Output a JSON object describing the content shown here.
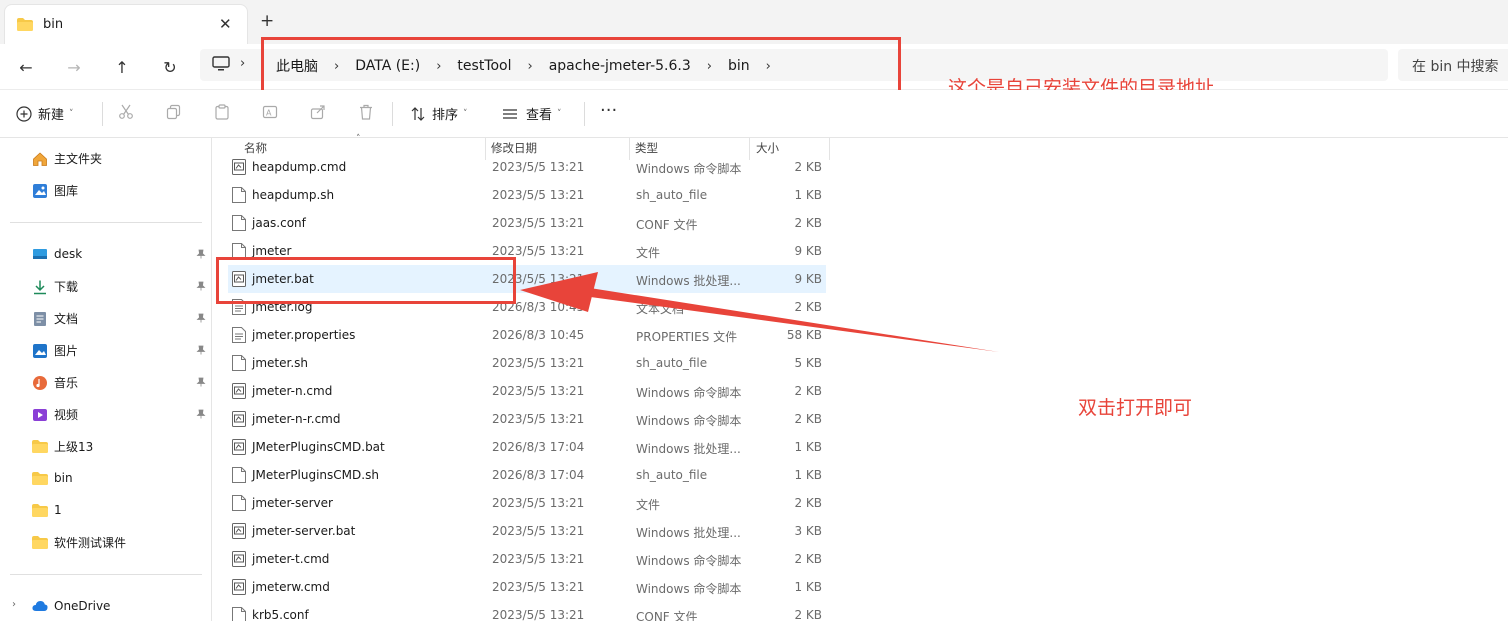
{
  "window": {
    "tab_title": "bin",
    "tab_close": "✕",
    "new_tab": "+"
  },
  "nav": {
    "back": "←",
    "forward": "→",
    "up": "↑",
    "refresh": "↻"
  },
  "address": {
    "chevron": "›",
    "crumbs": [
      "此电脑",
      "DATA (E:)",
      "testTool",
      "apache-jmeter-5.6.3",
      "bin"
    ],
    "search_text": "在 bin 中搜索"
  },
  "annotations": {
    "path_note": "这个是自己安装文件的目录地址",
    "open_note": "双击打开即可"
  },
  "toolbar": {
    "new_label": "新建",
    "sort_label": "排序",
    "view_label": "查看",
    "more_label": "···",
    "caret": "˅"
  },
  "sidebar": {
    "top": [
      {
        "label": "主文件夹",
        "icon": "home-icon"
      },
      {
        "label": "图库",
        "icon": "gallery-icon"
      }
    ],
    "pinned": [
      {
        "label": "desk",
        "icon": "desktop-icon",
        "pinned": true
      },
      {
        "label": "下载",
        "icon": "download-icon",
        "pinned": true
      },
      {
        "label": "文档",
        "icon": "document-icon",
        "pinned": true
      },
      {
        "label": "图片",
        "icon": "pictures-icon",
        "pinned": true
      },
      {
        "label": "音乐",
        "icon": "music-icon",
        "pinned": true
      },
      {
        "label": "视频",
        "icon": "video-icon",
        "pinned": true
      },
      {
        "label": "上级13",
        "icon": "folder-icon",
        "pinned": false
      },
      {
        "label": "bin",
        "icon": "folder-icon",
        "pinned": false
      },
      {
        "label": "1",
        "icon": "folder-icon",
        "pinned": false
      },
      {
        "label": "软件测试课件",
        "icon": "folder-icon",
        "pinned": false
      }
    ],
    "onedrive": {
      "label": "OneDrive",
      "icon": "cloud-icon",
      "expand": "›"
    },
    "pin_glyph": "📌"
  },
  "columns": {
    "name": "名称",
    "date": "修改日期",
    "type": "类型",
    "size": "大小",
    "sort_caret": "˄"
  },
  "files": [
    {
      "name": "heapdump.cmd",
      "date": "2023/5/5 13:21",
      "type": "Windows 命令脚本",
      "size": "2 KB",
      "icon": "script-file-icon"
    },
    {
      "name": "heapdump.sh",
      "date": "2023/5/5 13:21",
      "type": "sh_auto_file",
      "size": "1 KB",
      "icon": "file-icon"
    },
    {
      "name": "jaas.conf",
      "date": "2023/5/5 13:21",
      "type": "CONF 文件",
      "size": "2 KB",
      "icon": "file-icon"
    },
    {
      "name": "jmeter",
      "date": "2023/5/5 13:21",
      "type": "文件",
      "size": "9 KB",
      "icon": "file-icon"
    },
    {
      "name": "jmeter.bat",
      "date": "2023/5/5 13:21",
      "type": "Windows 批处理...",
      "size": "9 KB",
      "icon": "script-file-icon",
      "selected": true
    },
    {
      "name": "jmeter.log",
      "date": "2026/8/3 10:45",
      "type": "文本文档",
      "size": "2 KB",
      "icon": "text-file-icon"
    },
    {
      "name": "jmeter.properties",
      "date": "2026/8/3 10:45",
      "type": "PROPERTIES 文件",
      "size": "58 KB",
      "icon": "text-file-icon"
    },
    {
      "name": "jmeter.sh",
      "date": "2023/5/5 13:21",
      "type": "sh_auto_file",
      "size": "5 KB",
      "icon": "file-icon"
    },
    {
      "name": "jmeter-n.cmd",
      "date": "2023/5/5 13:21",
      "type": "Windows 命令脚本",
      "size": "2 KB",
      "icon": "script-file-icon"
    },
    {
      "name": "jmeter-n-r.cmd",
      "date": "2023/5/5 13:21",
      "type": "Windows 命令脚本",
      "size": "2 KB",
      "icon": "script-file-icon"
    },
    {
      "name": "JMeterPluginsCMD.bat",
      "date": "2026/8/3 17:04",
      "type": "Windows 批处理...",
      "size": "1 KB",
      "icon": "script-file-icon"
    },
    {
      "name": "JMeterPluginsCMD.sh",
      "date": "2026/8/3 17:04",
      "type": "sh_auto_file",
      "size": "1 KB",
      "icon": "file-icon"
    },
    {
      "name": "jmeter-server",
      "date": "2023/5/5 13:21",
      "type": "文件",
      "size": "2 KB",
      "icon": "file-icon"
    },
    {
      "name": "jmeter-server.bat",
      "date": "2023/5/5 13:21",
      "type": "Windows 批处理...",
      "size": "3 KB",
      "icon": "script-file-icon"
    },
    {
      "name": "jmeter-t.cmd",
      "date": "2023/5/5 13:21",
      "type": "Windows 命令脚本",
      "size": "2 KB",
      "icon": "script-file-icon"
    },
    {
      "name": "jmeterw.cmd",
      "date": "2023/5/5 13:21",
      "type": "Windows 命令脚本",
      "size": "1 KB",
      "icon": "script-file-icon"
    },
    {
      "name": "krb5.conf",
      "date": "2023/5/5 13:21",
      "type": "CONF 文件",
      "size": "2 KB",
      "icon": "file-icon"
    }
  ],
  "colors": {
    "annotation_red": "#e8443a",
    "selection_blue": "#e5f3ff",
    "folder_yellow": "#f7c948"
  }
}
